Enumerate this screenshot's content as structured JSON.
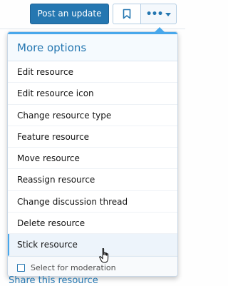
{
  "toolbar": {
    "post_update_label": "Post an update",
    "bookmark_icon": "bookmark-icon",
    "more_icon": "ellipsis-icon",
    "more_caret_icon": "caret-down-icon"
  },
  "menu": {
    "title": "More options",
    "items": [
      {
        "label": "Edit resource"
      },
      {
        "label": "Edit resource icon"
      },
      {
        "label": "Change resource type"
      },
      {
        "label": "Feature resource"
      },
      {
        "label": "Move resource"
      },
      {
        "label": "Reassign resource"
      },
      {
        "label": "Change discussion thread"
      },
      {
        "label": "Delete resource"
      },
      {
        "label": "Stick resource"
      }
    ],
    "footer_checkbox_label": "Select for moderation"
  },
  "below": {
    "share_label": "Share this resource"
  },
  "colors": {
    "accent": "#2577b1",
    "accent_light": "#47a7eb"
  }
}
